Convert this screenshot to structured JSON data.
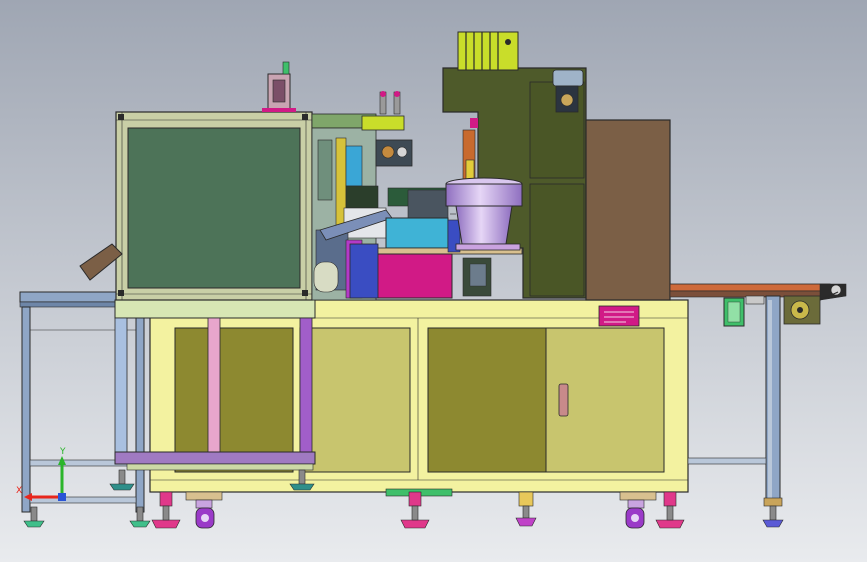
{
  "viewport": {
    "background_top": "#9fa6b3",
    "background_bottom": "#e9ebee"
  },
  "colors": {
    "frame_yellow": "#f3f2a0",
    "door_olive": "#8d8930",
    "door_khaki": "#c8c56e",
    "machine_body": "#4e5a2a",
    "panel_green": "#4d7358",
    "side_box": "#7b5f46",
    "bowl_lavender": "#b08ed8",
    "cyan_block": "#3fb3d6",
    "magenta": "#d11a86",
    "conveyor_orange": "#ce6a3a",
    "leg_blue": "#8fa6c6",
    "lime": "#c9dd2a",
    "pink_foot": "#e0388a"
  },
  "triad": {
    "x_label": "X",
    "y_label": "Y",
    "x_color": "#e8261c",
    "y_color": "#2bb52b",
    "z_color": "#2a55d6"
  }
}
